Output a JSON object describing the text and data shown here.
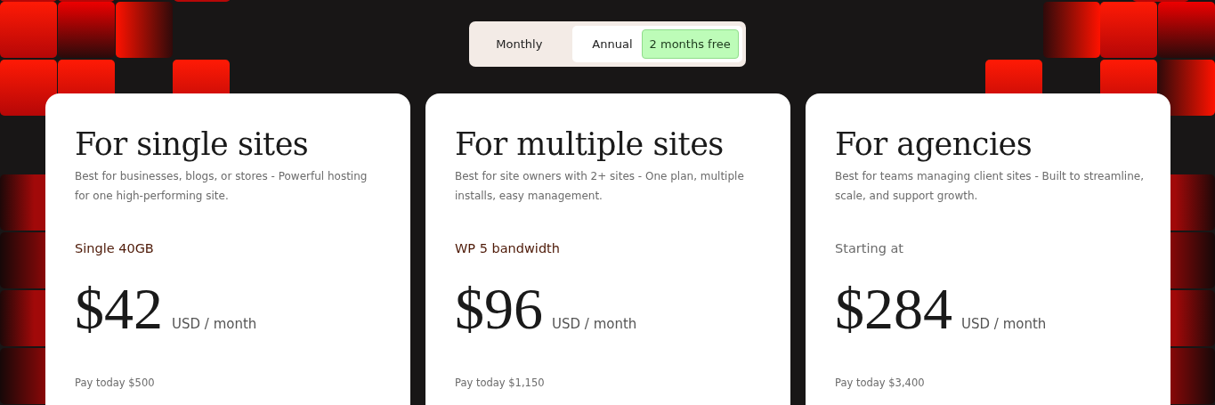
{
  "billing_toggle": {
    "options": [
      {
        "label": "Monthly",
        "selected": false
      },
      {
        "label": "Annual",
        "selected": true,
        "badge": "2 months free"
      }
    ]
  },
  "plans": [
    {
      "title": "For single sites",
      "description": "Best for businesses, blogs, or stores - Powerful hosting for one high-performing site.",
      "plan_label": {
        "kind": "plan",
        "text": "Single 40GB"
      },
      "price": "$42",
      "unit": "USD / month",
      "pay_today": "Pay today $500"
    },
    {
      "title": "For multiple sites",
      "description": "Best for site owners with 2+ sites - One plan, multiple installs, easy management.",
      "plan_label": {
        "kind": "plan",
        "text": "WP 5 bandwidth"
      },
      "price": "$96",
      "unit": "USD / month",
      "pay_today": "Pay today $1,150"
    },
    {
      "title": "For agencies",
      "description": "Best for teams managing client sites - Built to streamline, scale, and support growth.",
      "plan_label": {
        "kind": "starting",
        "text": "Starting at"
      },
      "price": "$284",
      "unit": "USD / month",
      "pay_today": "Pay today $3,400"
    }
  ]
}
